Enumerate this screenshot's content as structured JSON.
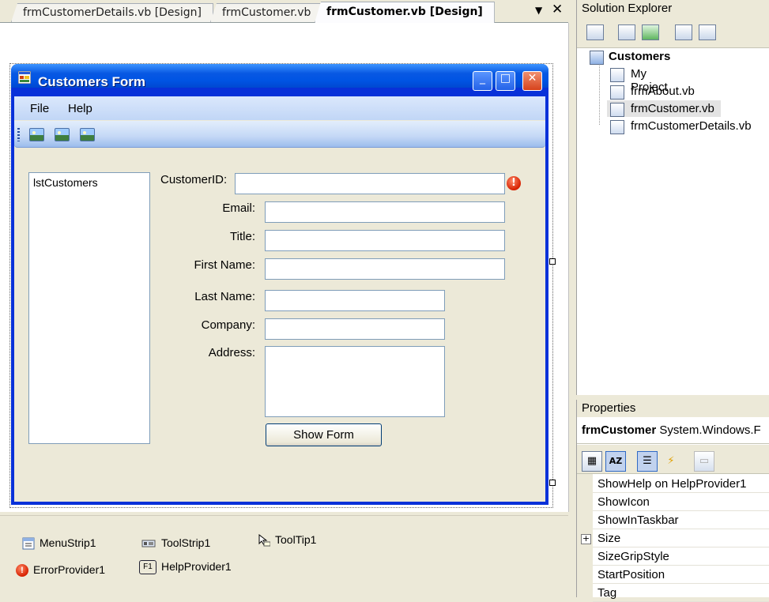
{
  "tabs": [
    {
      "label": "frmCustomerDetails.vb [Design]",
      "active": false
    },
    {
      "label": "frmCustomer.vb",
      "active": false
    },
    {
      "label": "frmCustomer.vb [Design]",
      "active": true
    }
  ],
  "tab_controls": {
    "dropdown_icon": "chevron-down-icon",
    "close_icon": "close-icon",
    "dropdown_glyph": "▼",
    "close_glyph": "✕"
  },
  "form": {
    "title": "Customers Form",
    "caption_buttons": {
      "minimize": "_",
      "maximize": "□",
      "close": "✕"
    },
    "menu": [
      "File",
      "Help"
    ],
    "listbox_label": "lstCustomers",
    "fields": [
      {
        "label": "CustomerID:",
        "value": ""
      },
      {
        "label": "Email:",
        "value": ""
      },
      {
        "label": "Title:",
        "value": ""
      },
      {
        "label": "First Name:",
        "value": ""
      },
      {
        "label": "Last Name:",
        "value": ""
      },
      {
        "label": "Company:",
        "value": ""
      },
      {
        "label": "Address:",
        "value": ""
      }
    ],
    "error_glyph": "!",
    "show_button": "Show Form"
  },
  "tray": [
    "MenuStrip1",
    "ToolStrip1",
    "ToolTip1",
    "ErrorProvider1",
    "HelpProvider1"
  ],
  "tray_f1_glyph": "F1",
  "solution_explorer": {
    "title": "Solution Explorer",
    "root": "Customers",
    "items": [
      "My Project",
      "frmAbout.vb",
      "frmCustomer.vb",
      "frmCustomerDetails.vb"
    ],
    "selected_index": 2
  },
  "properties": {
    "title": "Properties",
    "object_name": "frmCustomer",
    "object_type": "System.Windows.F",
    "toolbar_glyphs": {
      "categorized": "▦",
      "alphabetical": "AZ",
      "properties": "☰",
      "events": "⚡",
      "pages": "▭"
    },
    "rows": [
      "ShowHelp on HelpProvider1",
      "ShowIcon",
      "ShowInTaskbar",
      "Size",
      "SizeGripStyle",
      "StartPosition",
      "Tag"
    ],
    "expand_glyph": "+"
  },
  "colors": {
    "title_blue": "#0054e3",
    "window_border": "#0831d9",
    "selection": "#c1d2ee"
  }
}
